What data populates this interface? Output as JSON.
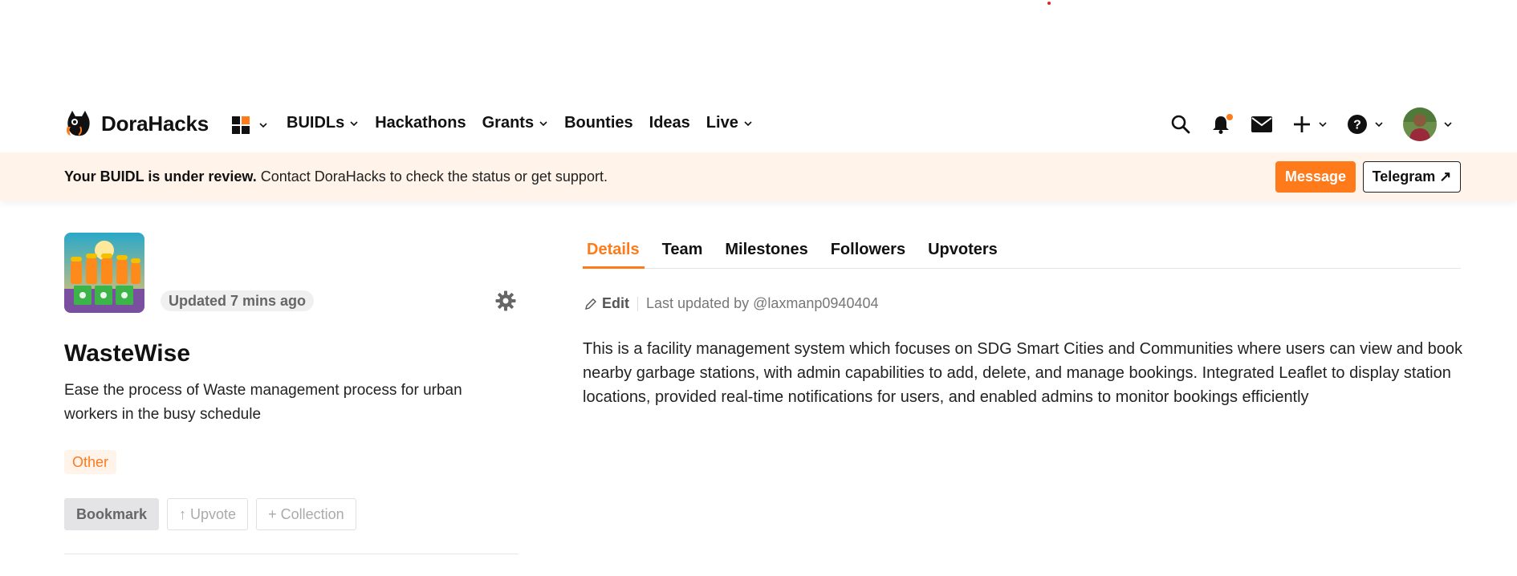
{
  "brand": {
    "name": "DoraHacks",
    "accent": "#ff7a1a"
  },
  "nav": {
    "items": [
      {
        "label": "BUIDLs",
        "has_dropdown": true
      },
      {
        "label": "Hackathons",
        "has_dropdown": false
      },
      {
        "label": "Grants",
        "has_dropdown": true
      },
      {
        "label": "Bounties",
        "has_dropdown": false
      },
      {
        "label": "Ideas",
        "has_dropdown": false
      },
      {
        "label": "Live",
        "has_dropdown": true
      }
    ],
    "icons": [
      "apps-grid-icon",
      "search-icon",
      "bell-icon",
      "mail-icon",
      "plus-icon",
      "help-icon",
      "avatar"
    ]
  },
  "banner": {
    "bold": "Your BUIDL is under review.",
    "text": " Contact DoraHacks to check the status or get support.",
    "message_label": "Message",
    "telegram_label": "Telegram ↗"
  },
  "project": {
    "updated": "Updated 7 mins ago",
    "title": "WasteWise",
    "tagline": "Ease the process of Waste management process for urban workers in the busy schedule",
    "tag": "Other",
    "actions": {
      "bookmark": "Bookmark",
      "upvote": "↑ Upvote",
      "collection": "+ Collection"
    }
  },
  "tabs": [
    "Details",
    "Team",
    "Milestones",
    "Followers",
    "Upvoters"
  ],
  "details": {
    "edit_label": "Edit",
    "last_updated": "Last updated by @laxmanp0940404",
    "description": "This is a facility management system which focuses on SDG Smart Cities and Communities where users can view and book nearby garbage stations, with admin capabilities to add, delete, and manage bookings. Integrated Leaflet to display station locations, provided real-time notifications for users, and enabled admins to monitor bookings efficiently"
  }
}
